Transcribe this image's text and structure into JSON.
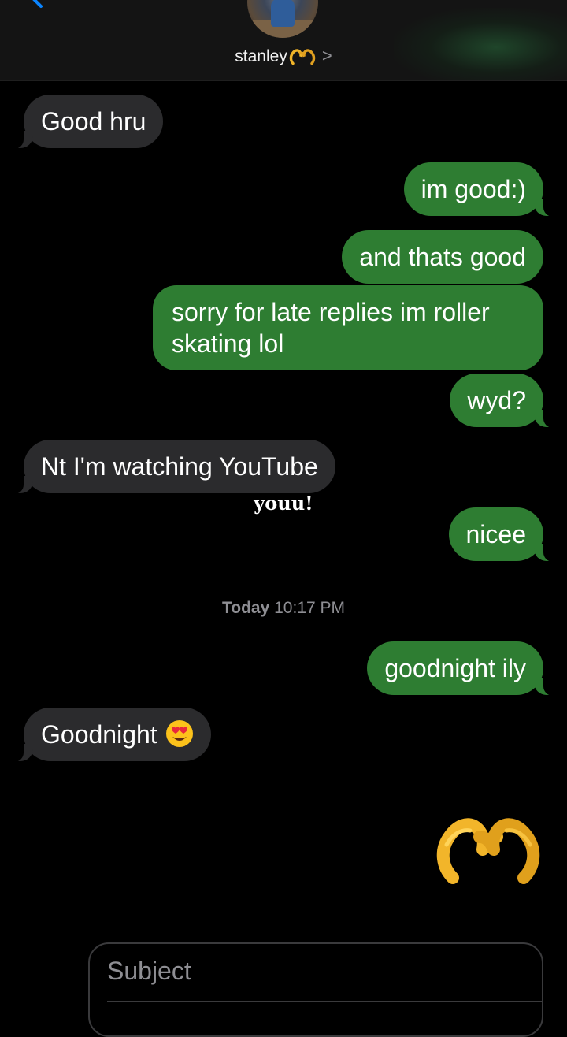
{
  "header": {
    "contact_name": "stanley",
    "contact_emoji_icon": "heart-hands-icon",
    "chevron": ">"
  },
  "messages": [
    {
      "side": "in",
      "text": "Good hru"
    },
    {
      "side": "out",
      "text": "im good:)"
    },
    {
      "side": "out",
      "text": "and thats good"
    },
    {
      "side": "out",
      "text": "sorry for late replies im roller skating lol"
    },
    {
      "side": "out",
      "text": "wyd?"
    },
    {
      "side": "in",
      "text": "Nt I'm watching YouTube"
    },
    {
      "side": "out",
      "text": "nicee"
    },
    {
      "side": "out",
      "text": "goodnight ily"
    },
    {
      "side": "in",
      "text": "Goodnight",
      "emoji_icon": "heart-eyes-face-icon"
    },
    {
      "side": "out",
      "emoji_icon": "heart-hands-icon"
    }
  ],
  "overlay_caption": "youu!",
  "timestamp": {
    "day": "Today",
    "time": "10:17 PM"
  },
  "composer": {
    "subject_placeholder": "Subject"
  },
  "colors": {
    "background": "#000000",
    "incoming_bubble": "#2b2b2d",
    "outgoing_bubble": "#2e7d32",
    "secondary_text": "#8e8e93",
    "back_chevron": "#0a84ff"
  }
}
